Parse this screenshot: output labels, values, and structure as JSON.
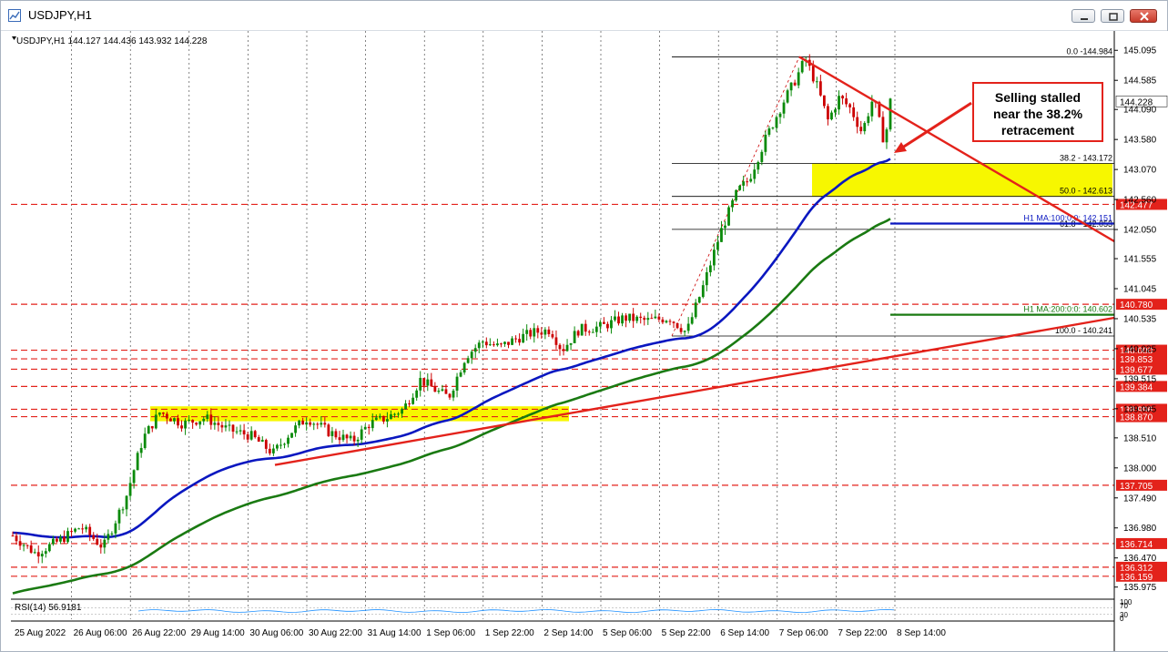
{
  "window": {
    "title": "USDJPY,H1",
    "buttons": [
      "minimize",
      "restore",
      "close"
    ]
  },
  "chart_header": "USDJPY,H1  144.127 144.436 143.932 144.228",
  "colors": {
    "bull": "#0a8a0a",
    "bear": "#cc0000",
    "ma100": "#0a17c0",
    "ma200": "#1a7a12",
    "trendline": "#e3221b",
    "zone": "#f7f700",
    "fib": "#000000",
    "level": "#e3221b"
  },
  "annotation": {
    "lines": [
      "Selling stalled",
      "near the 38.2%",
      "retracement"
    ]
  },
  "chart_data": {
    "type": "candlestick",
    "symbol": "USDJPY",
    "timeframe": "H1",
    "ohlc_header": {
      "open": 144.127,
      "high": 144.436,
      "low": 143.932,
      "close": 144.228
    },
    "ylim": [
      135.8,
      145.3
    ],
    "y_ticks": [
      "145.095",
      "144.585",
      "144.090",
      "143.580",
      "143.070",
      "142.560",
      "142.050",
      "141.555",
      "141.045",
      "140.535",
      "140.025",
      "139.515",
      "139.005",
      "138.510",
      "138.000",
      "137.490",
      "136.980",
      "136.470",
      "135.975"
    ],
    "y_tick_values": [
      145.095,
      144.585,
      144.09,
      143.58,
      143.07,
      142.56,
      142.05,
      141.555,
      141.045,
      140.535,
      140.025,
      139.515,
      139.005,
      138.51,
      138.0,
      137.49,
      136.98,
      136.47,
      135.975
    ],
    "x_ticks": [
      "25 Aug 2022",
      "26 Aug 06:00",
      "26 Aug 22:00",
      "29 Aug 14:00",
      "30 Aug 06:00",
      "30 Aug 22:00",
      "31 Aug 14:00",
      "1 Sep 06:00",
      "1 Sep 22:00",
      "2 Sep 14:00",
      "5 Sep 06:00",
      "5 Sep 22:00",
      "6 Sep 14:00",
      "7 Sep 06:00",
      "7 Sep 22:00",
      "8 Sep 14:00"
    ],
    "price_path": [
      [
        0,
        136.85
      ],
      [
        4,
        136.55
      ],
      [
        8,
        136.75
      ],
      [
        12,
        137.0
      ],
      [
        16,
        136.65
      ],
      [
        20,
        137.5
      ],
      [
        23,
        138.5
      ],
      [
        26,
        138.95
      ],
      [
        30,
        138.75
      ],
      [
        34,
        138.85
      ],
      [
        38,
        138.65
      ],
      [
        42,
        138.55
      ],
      [
        46,
        138.25
      ],
      [
        49,
        138.6
      ],
      [
        52,
        138.85
      ],
      [
        56,
        138.6
      ],
      [
        60,
        138.45
      ],
      [
        63,
        138.75
      ],
      [
        66,
        138.85
      ],
      [
        69,
        139.0
      ],
      [
        72,
        139.5
      ],
      [
        75,
        139.3
      ],
      [
        77,
        139.2
      ],
      [
        80,
        139.9
      ],
      [
        83,
        140.15
      ],
      [
        86,
        140.05
      ],
      [
        89,
        140.2
      ],
      [
        92,
        140.3
      ],
      [
        95,
        140.35
      ],
      [
        97,
        140.0
      ],
      [
        100,
        140.35
      ],
      [
        104,
        140.4
      ],
      [
        108,
        140.55
      ],
      [
        112,
        140.5
      ],
      [
        116,
        140.55
      ],
      [
        119,
        140.3
      ],
      [
        122,
        141.1
      ],
      [
        125,
        142.0
      ],
      [
        128,
        142.7
      ],
      [
        130,
        142.9
      ],
      [
        133,
        143.6
      ],
      [
        136,
        144.2
      ],
      [
        138,
        144.55
      ],
      [
        140,
        144.95
      ],
      [
        142,
        144.5
      ],
      [
        144,
        143.9
      ],
      [
        146,
        144.3
      ],
      [
        148,
        144.1
      ],
      [
        150,
        143.7
      ],
      [
        152,
        144.3
      ],
      [
        154,
        143.5
      ],
      [
        155,
        144.228
      ]
    ],
    "price_x_range": [
      0,
      155
    ],
    "price_path_note_hidden": true,
    "levels_red_dashed": [
      "142.477",
      "140.780",
      "140.000",
      "139.853",
      "139.677",
      "139.384",
      "138.996",
      "138.870",
      "137.705",
      "136.714",
      "136.312",
      "136.159"
    ],
    "level_values": [
      142.477,
      140.78,
      140.0,
      139.853,
      139.677,
      139.384,
      138.996,
      138.87,
      137.705,
      136.714,
      136.312,
      136.159
    ],
    "current_price": "144.228",
    "fib_levels": [
      {
        "label": "0.0 -144.984",
        "value": 144.984
      },
      {
        "label": "38.2 - 143.172",
        "value": 143.172
      },
      {
        "label": "50.0 - 142.613",
        "value": 142.613
      },
      {
        "label": "61.8 - 142.053",
        "value": 142.053
      },
      {
        "label": "100.0 - 140.241",
        "value": 140.241
      }
    ],
    "ma100": {
      "label": "H1 MA:100:0:0: 142.151",
      "value": 142.151
    },
    "ma200": {
      "label": "H1 MA:200:0:0: 140.602",
      "value": 140.602
    },
    "support_zone": {
      "from": 138.87,
      "to": 139.0
    },
    "retrace_zone": {
      "from": 142.613,
      "to": 143.172
    },
    "rsi": {
      "label": "RSI(14) 56.9181",
      "value": 56.9181,
      "ticks": [
        "100",
        "70",
        "30",
        "0"
      ]
    }
  }
}
